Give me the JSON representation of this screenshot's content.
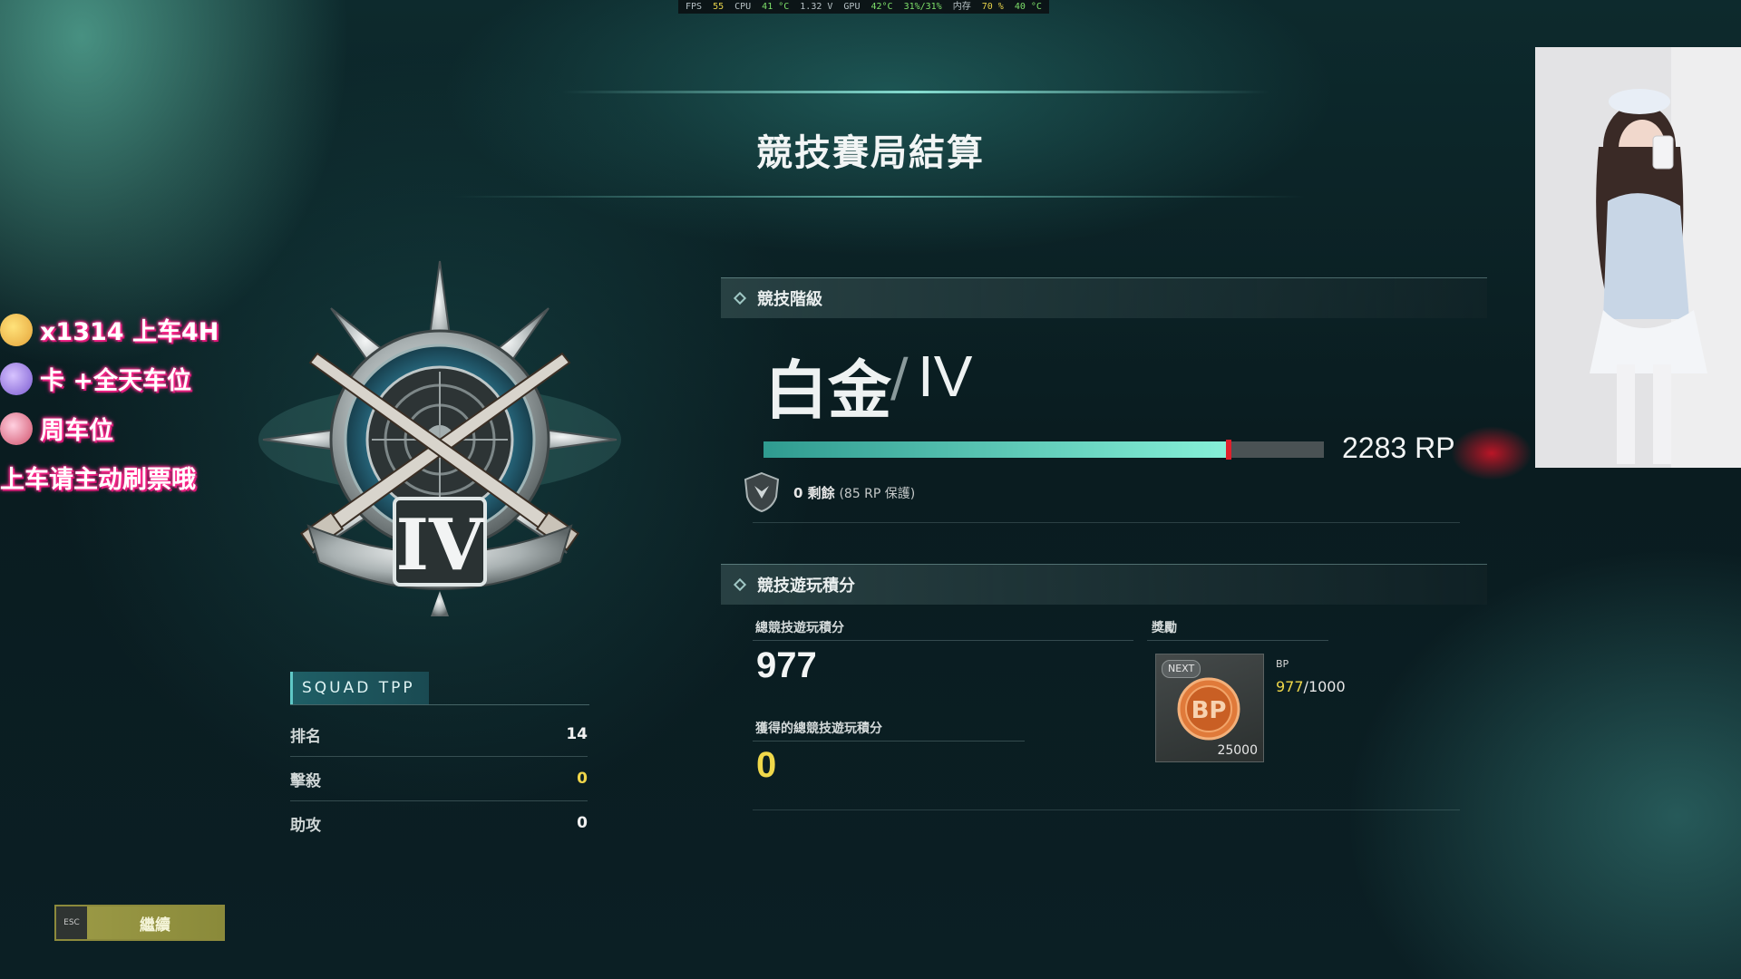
{
  "perf_overlay": {
    "fps_label": "FPS",
    "fps": "55",
    "cpu_label": "CPU",
    "cpu_temp": "41 °C",
    "cpu_volt": "1.32 V",
    "gpu_label": "GPU",
    "gpu_temp": "42°C",
    "gpu_usage": "31%/31%",
    "mem_label": "内存",
    "mem_usage": "70 %",
    "mem_temp": "40 °C"
  },
  "title": "競技賽局結算",
  "overlay_text": {
    "line1": "x1314 上车4H",
    "line2": "卡 +全天车位",
    "line3": "周车位",
    "line4": "上车请主动刷票哦"
  },
  "mode": {
    "label": "SQUAD TPP",
    "stats": [
      {
        "label": "排名",
        "value": "14"
      },
      {
        "label": "擊殺",
        "value": "0"
      },
      {
        "label": "助攻",
        "value": "0"
      }
    ]
  },
  "rank_section": {
    "header": "競技階級",
    "tier": "白金",
    "separator": "/",
    "division": "IV",
    "rp_value": "2283 RP",
    "rp_progress": 0.83,
    "protection_count": "0 剩餘",
    "protection_note": "(85 RP 保護)"
  },
  "points_section": {
    "header": "競技遊玩積分",
    "total_label": "總競技遊玩積分",
    "total_value": "977",
    "earned_label": "獲得的總競技遊玩積分",
    "earned_value": "0",
    "reward_label": "獎勵",
    "next_badge": "NEXT",
    "bp_coin_text": "BP",
    "bp_amount": "25000",
    "bp_label": "BP",
    "bp_current": "977",
    "bp_target": "/1000"
  },
  "continue_button": {
    "key": "ESC",
    "label": "繼續"
  },
  "colors": {
    "accent_gold": "#f0d84a",
    "bar_teal": "#86f0d8",
    "bar_marker": "#e0202c"
  }
}
